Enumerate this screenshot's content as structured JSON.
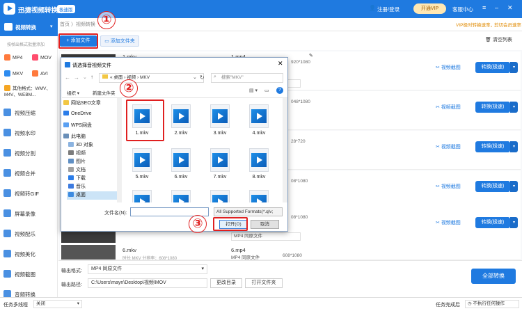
{
  "titlebar": {
    "app_title": "迅捷视频转换器",
    "edition_badge": "极速版",
    "login": "注册/登录",
    "vip": "开通VIP",
    "service": "客服中心"
  },
  "sidebar": {
    "active": "视频转换",
    "hint": "按帧出格式批量添加",
    "formats": [
      "MP4",
      "MOV",
      "MKV",
      "AVI"
    ],
    "other_formats": "其他格式：WMV、M4V、WEBM...",
    "items": [
      "视频压缩",
      "视频水印",
      "视频分割",
      "视频合并",
      "视频转GIF",
      "屏幕录像",
      "视频配乐",
      "视频美化",
      "视频截图",
      "音频转换"
    ]
  },
  "toolbar": {
    "breadcrumb": "首页 〉视频转换",
    "notice": "VIP极时转换速率，",
    "notice2": "剪切会员速率",
    "add_file": "添加文件",
    "add_folder": "添加文件夹",
    "clear_list": "清空列表"
  },
  "rows": [
    {
      "name": "1.mkv",
      "out": "1.mp4",
      "res": "920*1080",
      "format": "MP4  同原文件",
      "shot": "视频截图",
      "convert": "转换(极速)"
    },
    {
      "name": "",
      "out": "",
      "res": "048*1080",
      "format": "",
      "shot": "视频截图",
      "convert": "转换(极速)"
    },
    {
      "name": "",
      "out": "",
      "res": "28*720",
      "format": "",
      "shot": "视频截图",
      "convert": "转换(极速)"
    },
    {
      "name": "",
      "out": "",
      "res": "08*1080",
      "format": "",
      "shot": "视频截图",
      "convert": "转换(极速)"
    },
    {
      "name": "",
      "out": "",
      "res": "08*1080",
      "format": "MP4  同原文件",
      "shot": "视频截图",
      "convert": "转换(极速)"
    },
    {
      "name": "6.mkv",
      "out": "6.mp4",
      "res": "608*1080",
      "format": "MP4  同原文件",
      "shot": "视频截图",
      "convert": "转换(极速)"
    }
  ],
  "row6_meta": "时长   MKV      分辨率：608*1080",
  "bottom": {
    "format_label": "输出格式:",
    "format_value": "MP4  同原文件",
    "path_label": "输出路径:",
    "path_value": "C:\\Users\\mayn\\Desktop\\视频\\MOV",
    "change_dir": "更改目录",
    "open_folder": "打开文件夹",
    "convert_all": "全部转换"
  },
  "statusbar": {
    "multitask": "任务多线程",
    "multitask_value": "关闭",
    "after_label": "任务完成后",
    "after_value": "不执行任何操作"
  },
  "dialog": {
    "title": "请选择音视频文件",
    "path": [
      "桌面",
      "视频",
      "MKV"
    ],
    "search_placeholder": "搜索\"MKV\"",
    "organize": "组织 ▾",
    "new_folder": "新建文件夹",
    "tree": [
      "网站SEO文章",
      "OneDrive",
      "WPS网盘",
      "此电脑",
      "3D 对象",
      "视频",
      "图片",
      "文档",
      "下载",
      "音乐",
      "桌面"
    ],
    "files": [
      "1.mkv",
      "2.mkv",
      "3.mkv",
      "4.mkv",
      "5.mkv",
      "6.mkv",
      "7.mkv",
      "8.mkv",
      "",
      "",
      "",
      ""
    ],
    "filename_label": "文件名(N):",
    "filter": "All Supported Formats(*.qlv;",
    "open": "打开(O)",
    "cancel": "取消"
  },
  "annotations": [
    "①",
    "②",
    "③"
  ],
  "colors": {
    "accent": "#1f7ae0",
    "annotation": "#e02020"
  }
}
